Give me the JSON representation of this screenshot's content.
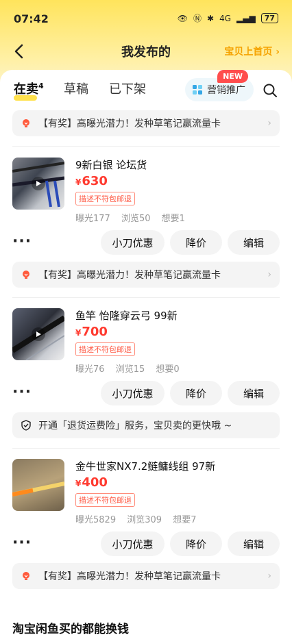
{
  "status": {
    "time": "07:42",
    "battery": "77",
    "network": "4G"
  },
  "nav": {
    "title": "我发布的",
    "right_link": "宝贝上首页"
  },
  "tabs": {
    "selling": "在卖",
    "selling_count": "4",
    "draft": "草稿",
    "offshelf": "已下架",
    "promo": "营销推广",
    "new_badge": "NEW"
  },
  "banners": [
    "【有奖】高曝光潜力！发种草笔记赢流量卡",
    "【有奖】高曝光潜力！发种草笔记赢流量卡",
    "开通「退货运费险」服务，宝贝卖的更快哦 ~",
    "【有奖】高曝光潜力！发种草笔记赢流量卡"
  ],
  "items": [
    {
      "title": "9新白银 论坛货",
      "currency": "¥",
      "price": "630",
      "tag": "描述不符包邮退",
      "exposure": "曝光177",
      "views": "浏览50",
      "wants": "想要1"
    },
    {
      "title": "鱼竿 怡隆穿云弓 99新",
      "currency": "¥",
      "price": "700",
      "tag": "描述不符包邮退",
      "exposure": "曝光76",
      "views": "浏览15",
      "wants": "想要0"
    },
    {
      "title": "金牛世家NX7.2鲢鳙线组 97新",
      "currency": "¥",
      "price": "400",
      "tag": "描述不符包邮退",
      "exposure": "曝光5829",
      "views": "浏览309",
      "wants": "想要7"
    }
  ],
  "actions": {
    "more": "···",
    "discount": "小刀优惠",
    "reduce": "降价",
    "edit": "编辑"
  },
  "footer": {
    "title": "淘宝闲鱼买的都能换钱"
  },
  "colors": {
    "accent": "#f5a300",
    "price": "#ff3b30",
    "header_bg": "#ffe45c"
  }
}
